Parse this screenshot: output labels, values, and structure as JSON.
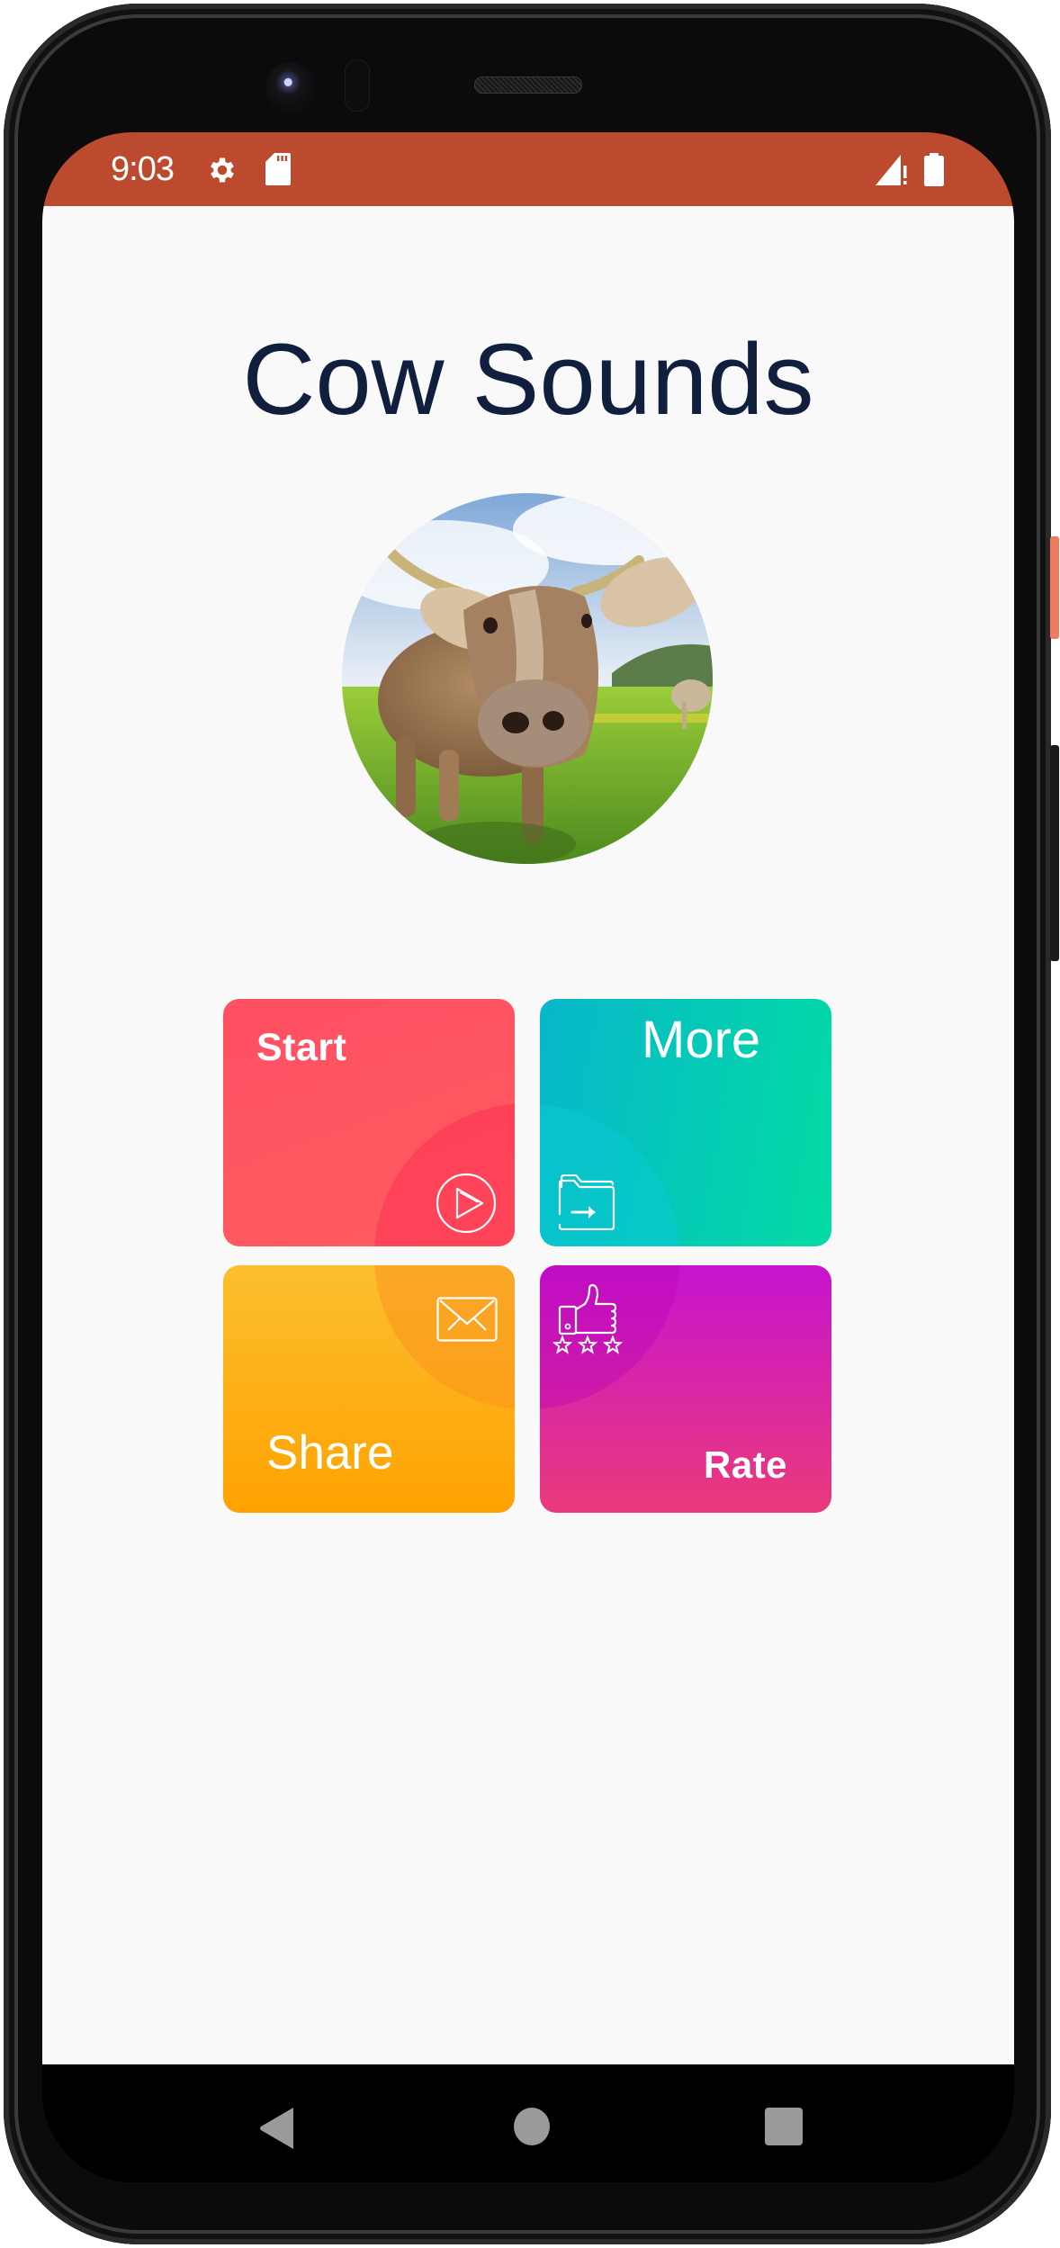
{
  "device": {
    "status_bar": {
      "time": "9:03",
      "icons_left": [
        "gear-icon",
        "sd-card-icon"
      ],
      "icons_right": [
        "signal-icon",
        "battery-icon"
      ],
      "color": "#bc4a2e"
    },
    "nav_bar": {
      "buttons": [
        "back",
        "home",
        "recents"
      ]
    }
  },
  "app": {
    "title": "Cow Sounds",
    "avatar_alt": "cow in a meadow",
    "tiles": [
      {
        "label": "Start",
        "icon": "play-circle-icon",
        "color_from": "#ff4f63",
        "color_to": "#ff5c5e"
      },
      {
        "label": "More",
        "icon": "folder-arrow-icon",
        "color_from": "#07b7cb",
        "color_to": "#03dba3"
      },
      {
        "label": "Share",
        "icon": "envelope-icon",
        "color_from": "#fbbf2f",
        "color_to": "#ffa200"
      },
      {
        "label": "Rate",
        "icon": "thumbs-up-stars-icon",
        "color_from": "#c714cf",
        "color_to": "#ea3a7a"
      }
    ]
  }
}
